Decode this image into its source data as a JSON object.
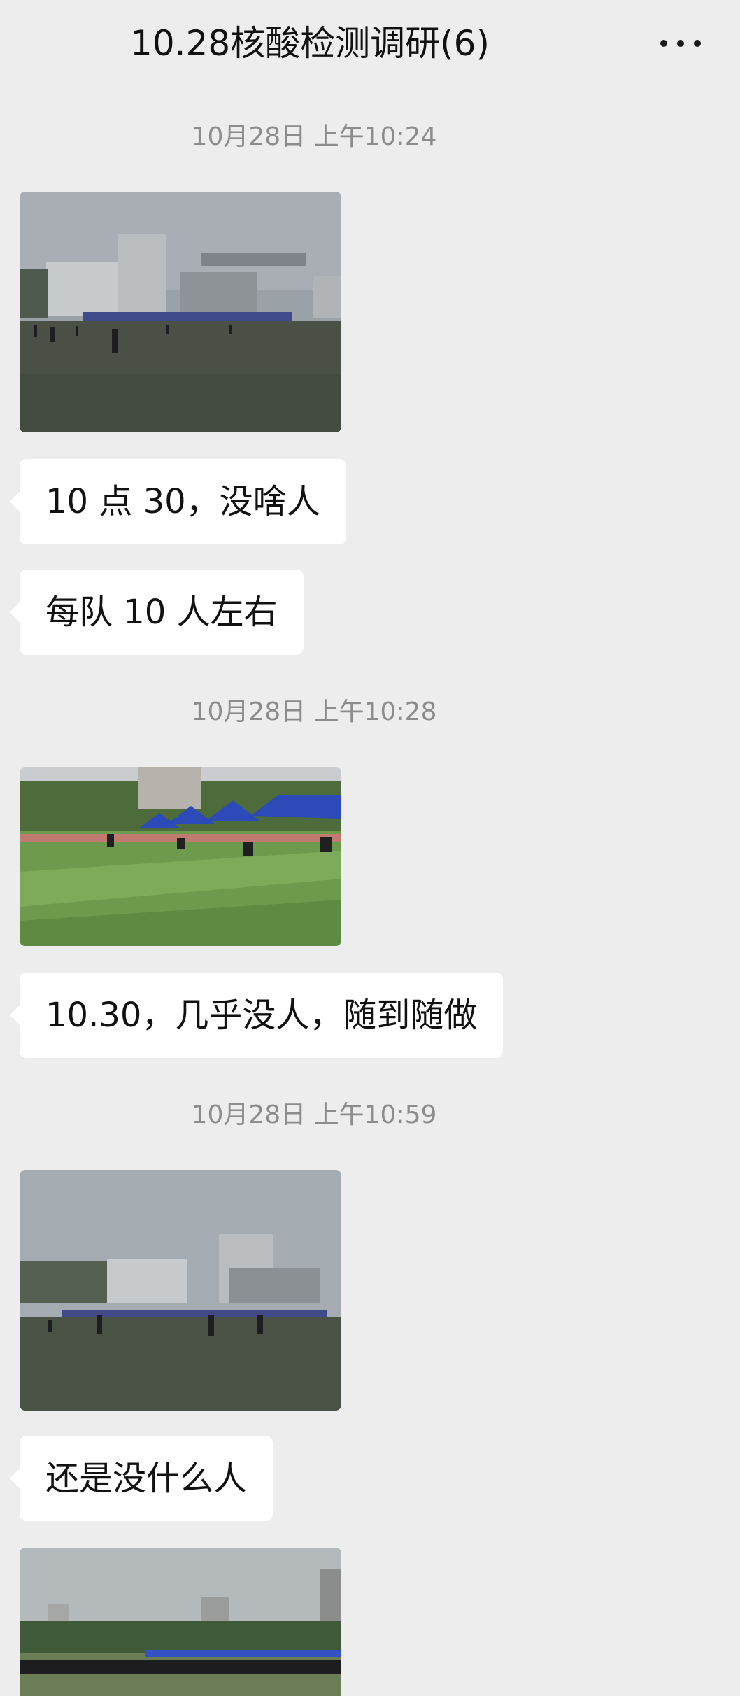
{
  "header": {
    "title": "10.28核酸检测调研(6)",
    "more_icon": "more-dots-icon"
  },
  "messages": [
    {
      "type": "timestamp",
      "text": "10月28日 上午10:24"
    },
    {
      "type": "image",
      "description": "football field with testing tents, buildings behind"
    },
    {
      "type": "text",
      "text": "10 点 30，没啥人"
    },
    {
      "type": "text",
      "text": "每队 10 人左右"
    },
    {
      "type": "timestamp",
      "text": "10月28日 上午10:28"
    },
    {
      "type": "image",
      "description": "blue canopy tents on green turf"
    },
    {
      "type": "text",
      "text": "10.30，几乎没人，随到随做"
    },
    {
      "type": "timestamp",
      "text": "10月28日 上午10:59"
    },
    {
      "type": "image",
      "description": "field with few people, buildings behind"
    },
    {
      "type": "text",
      "text": "还是没什么人"
    },
    {
      "type": "image",
      "description": "long queue of people by tents, city skyline"
    }
  ],
  "colors": {
    "background": "#ededed",
    "bubble": "#ffffff",
    "timestamp_text": "#8c8c8c",
    "text": "#111111"
  }
}
